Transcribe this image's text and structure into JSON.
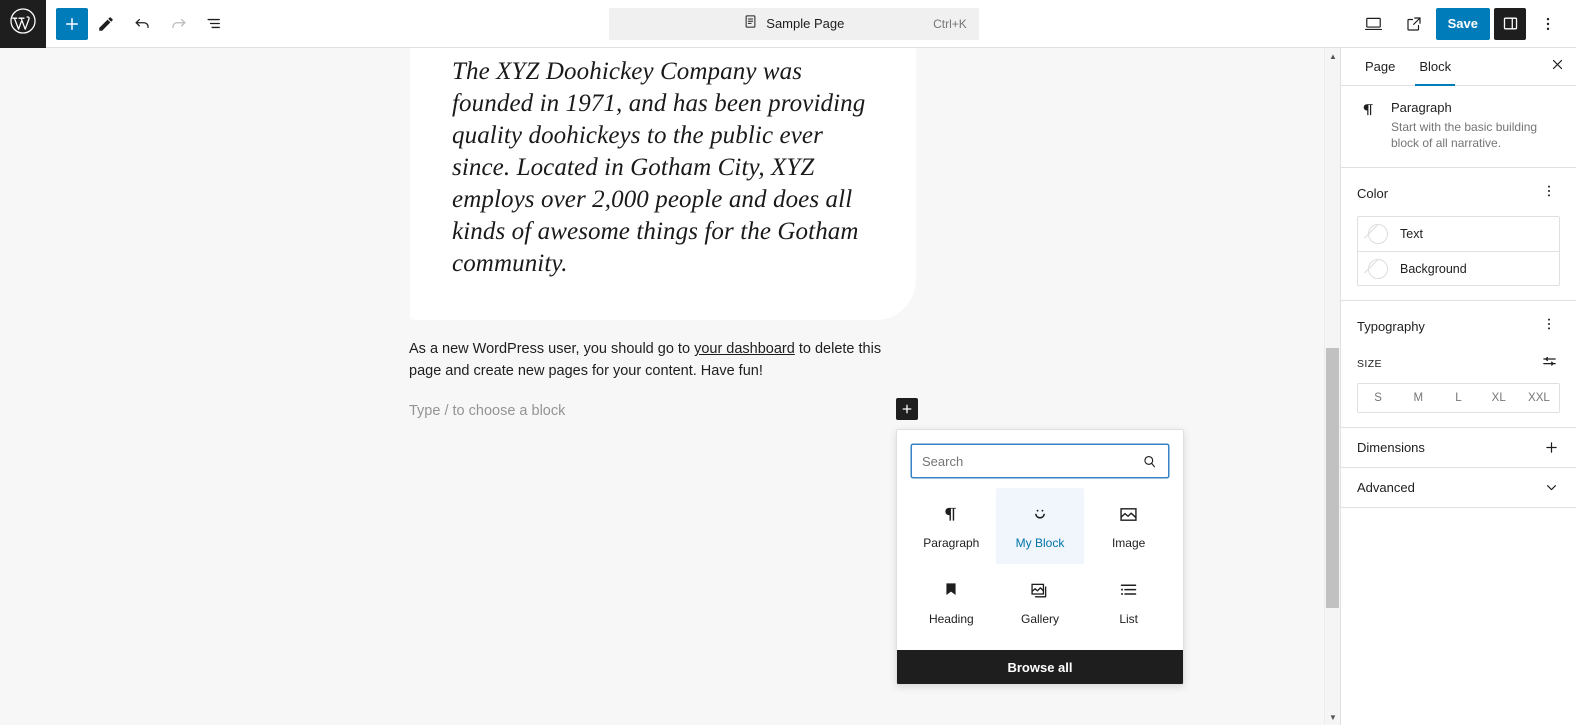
{
  "topbar": {
    "logo_icon": "wordpress-logo-icon",
    "left_tools": [
      {
        "name": "block-inserter-toggle",
        "icon": "plus-icon",
        "label": "Toggle block inserter",
        "style": "primary"
      },
      {
        "name": "tools-edit",
        "icon": "pencil-icon",
        "label": "Tools",
        "style": "plain"
      },
      {
        "name": "undo-button",
        "icon": "undo-icon",
        "label": "Undo",
        "style": "plain"
      },
      {
        "name": "redo-button",
        "icon": "redo-icon",
        "label": "Redo",
        "style": "disabled"
      },
      {
        "name": "document-overview",
        "icon": "list-view-icon",
        "label": "Document Overview",
        "style": "plain"
      }
    ],
    "document_bar": {
      "icon": "page-icon",
      "title": "Sample Page",
      "shortcut": "Ctrl+K"
    },
    "right_tools": [
      {
        "name": "preview-button",
        "icon": "desktop-icon",
        "label": "View"
      },
      {
        "name": "view-site-button",
        "icon": "external-link-icon",
        "label": "View site"
      }
    ],
    "save_label": "Save",
    "settings_icon": "sidebar-panel-icon",
    "options_icon": "vertical-dots-icon"
  },
  "editor": {
    "quote_text": "The XYZ Doohickey Company was founded in 1971, and has been providing quality doohickeys to the public ever since. Located in Gotham City, XYZ employs over 2,000 people and does all kinds of awesome things for the Gotham community.",
    "paragraph": {
      "before_link": "As a new WordPress user, you should go to ",
      "link_text": "your dashboard",
      "after_link": " to delete this page and create new pages for your content. Have fun!"
    },
    "empty_placeholder": "Type / to choose a block",
    "inline_inserter_icon": "plus-icon"
  },
  "inserter": {
    "search_placeholder": "Search",
    "search_value": "",
    "search_icon": "search-icon",
    "blocks": [
      {
        "label": "Paragraph",
        "icon": "paragraph-pilcrow-icon",
        "selected": false
      },
      {
        "label": "My Block",
        "icon": "smiley-face-icon",
        "selected": true
      },
      {
        "label": "Image",
        "icon": "image-icon",
        "selected": false
      },
      {
        "label": "Heading",
        "icon": "heading-bookmark-icon",
        "selected": false
      },
      {
        "label": "Gallery",
        "icon": "gallery-icon",
        "selected": false
      },
      {
        "label": "List",
        "icon": "list-icon",
        "selected": false
      }
    ],
    "browse_all_label": "Browse all"
  },
  "sidebar": {
    "tabs": [
      {
        "label": "Page",
        "active": false
      },
      {
        "label": "Block",
        "active": true
      }
    ],
    "close_icon": "close-icon",
    "block_info": {
      "icon": "paragraph-pilcrow-icon",
      "title": "Paragraph",
      "description": "Start with the basic building block of all narrative."
    },
    "color": {
      "title": "Color",
      "options_icon": "vertical-dots-icon",
      "rows": [
        {
          "label": "Text",
          "swatch": "none"
        },
        {
          "label": "Background",
          "swatch": "none"
        }
      ]
    },
    "typography": {
      "title": "Typography",
      "options_icon": "vertical-dots-icon",
      "size_label": "SIZE",
      "size_settings_icon": "sliders-icon",
      "sizes": [
        "S",
        "M",
        "L",
        "XL",
        "XXL"
      ]
    },
    "dimensions": {
      "title": "Dimensions",
      "icon": "plus-icon"
    },
    "advanced": {
      "title": "Advanced",
      "icon": "chevron-down-icon"
    }
  },
  "colors": {
    "accent": "#007cba",
    "dark": "#1e1e1e",
    "canvas_bg": "#f7f7f7",
    "selected_block_bg": "#f0f6fc",
    "selected_block_text": "#0073aa"
  }
}
